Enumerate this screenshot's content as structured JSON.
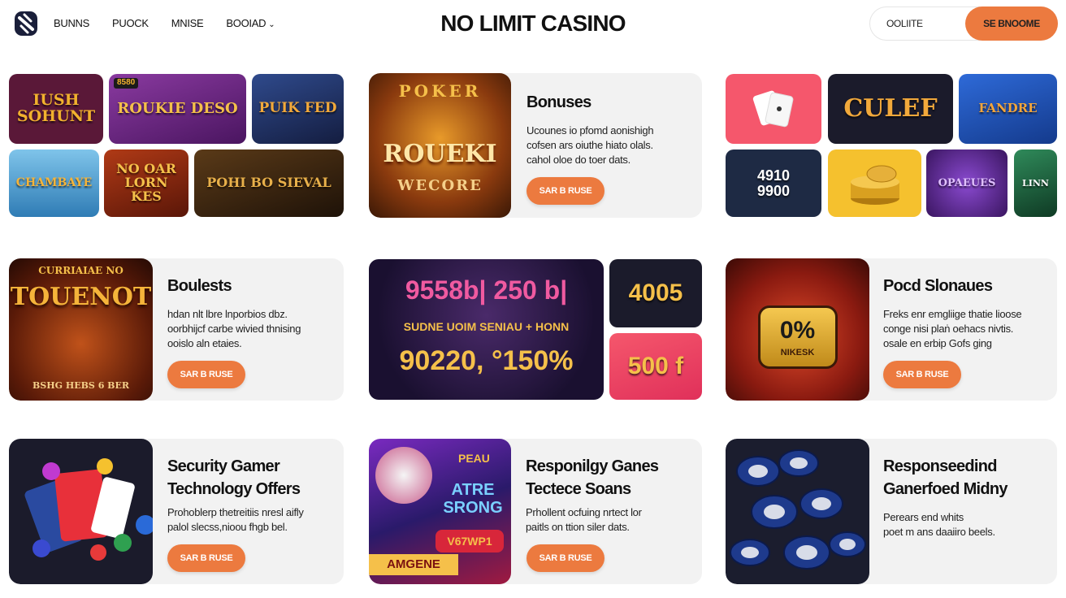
{
  "header": {
    "brand": "NO LIMIT CASINO",
    "nav": [
      "BUNNS",
      "PUOCK",
      "MNISE",
      "BOOIAD"
    ],
    "pill_text": "OOLIITE",
    "pill_button": "SE BNOOME"
  },
  "colors": {
    "accent": "#ec7a3f",
    "card_bg": "#f2f2f2",
    "text": "#111111"
  },
  "tiles_group_1": [
    {
      "label": "IUSH SOHUNT",
      "bg": "#5a1838",
      "fg": "#f2b12e"
    },
    {
      "label": "ROUKIE DESO",
      "bg": "#7a2a8c",
      "fg": "#f5c04a",
      "badge": "8580"
    },
    {
      "label": "PUIK FED",
      "bg": "#1f2f66",
      "fg": "#f2a93b"
    },
    {
      "label": "CHAMBAYE",
      "bg": "#4fa6d8",
      "fg": "#f5b43a"
    },
    {
      "label": "NO OAR LORN KES",
      "bg": "#8a2a12",
      "fg": "#f5c04a"
    },
    {
      "label": "POHI BO SIEVAL",
      "bg": "#3a2510",
      "fg": "#e8b04a"
    }
  ],
  "feature_poker": {
    "tile_top": "POKER",
    "tile_main": "ROUEKI",
    "tile_sub": "WECORE",
    "title": "Bonuses",
    "desc": [
      "Ucounes io pfomd aonishigh",
      "cofsen ars oiuthe hiato olals.",
      "cahol oloe do toer dats."
    ],
    "cta": "SAR B RUSE"
  },
  "tiles_group_2": [
    {
      "label": "",
      "bg": "#f5576c",
      "fg": "#ffffff",
      "icon": "cards-icon"
    },
    {
      "label": "CULEF",
      "bg": "#1b1b2b",
      "fg": "#f2a93b"
    },
    {
      "label": "FANDRE",
      "bg": "#1e5bbf",
      "fg": "#f5a63a"
    },
    {
      "label": "4910 9900",
      "bg": "#1e2a44",
      "fg": "#ffffff"
    },
    {
      "label": "",
      "bg": "#f5c12e",
      "fg": "#b07a10",
      "icon": "coins-icon"
    },
    {
      "label": "OPAEUES",
      "bg": "#5a2a8c",
      "fg": "#e0c0ff"
    },
    {
      "label": "LINN",
      "bg": "#1f6a40",
      "fg": "#ffffff"
    }
  ],
  "row2_left": {
    "tile_top": "CURRIAIAE NO",
    "tile_main": "TOUENOT",
    "tile_sub": "BSHG HEBS 6 BER",
    "title": "Boulests",
    "desc": [
      "hdan nlt lbre lnporbios dbz.",
      "oorbhijcf carbe wivied thnising",
      "ooislo aln etaies."
    ],
    "cta": "SAR B RUSE"
  },
  "stats_panel": {
    "line1": "9558b|  250 b|",
    "line2": "SUDNE UOIM SENIAU + HONN",
    "line3": "90220,  °150%",
    "side_top": "4005",
    "side_bottom": "500 f"
  },
  "row2_right": {
    "tile_main": "0%",
    "tile_sub": "NIKESK",
    "title": "Pocd Slonaues",
    "desc": [
      "Freks enr emgliige  thatie lioose",
      "conge nisi plaṅ oehacs nivtis.",
      "osale en erbip Gofs ging"
    ],
    "cta": "SAR B RUSE"
  },
  "row3_left": {
    "title": [
      "Security Gamer",
      "Technology Offers"
    ],
    "desc": [
      "Prohoblerp thetreitiis nresl aifly",
      "palol slecss,nioou fhgb bel."
    ],
    "cta": "SAR B RUSE"
  },
  "row3_mid": {
    "tile_top": "PEAU",
    "tile_main": "ATRE SRONG",
    "tile_bottom": "AMGENE",
    "tile_badge": "V67WP1",
    "title": [
      "Responilgy Ganes",
      "Tectece Soans"
    ],
    "desc": [
      "Prhollent ocfuing nrtect lor",
      "paitls on ttion siler dats."
    ],
    "cta": "SAR B RUSE"
  },
  "row3_right": {
    "title": [
      "Responseedind",
      "Ganerfoed Midny"
    ],
    "desc": [
      "Perears end whits",
      "poet m ans daaiiro beels."
    ]
  }
}
